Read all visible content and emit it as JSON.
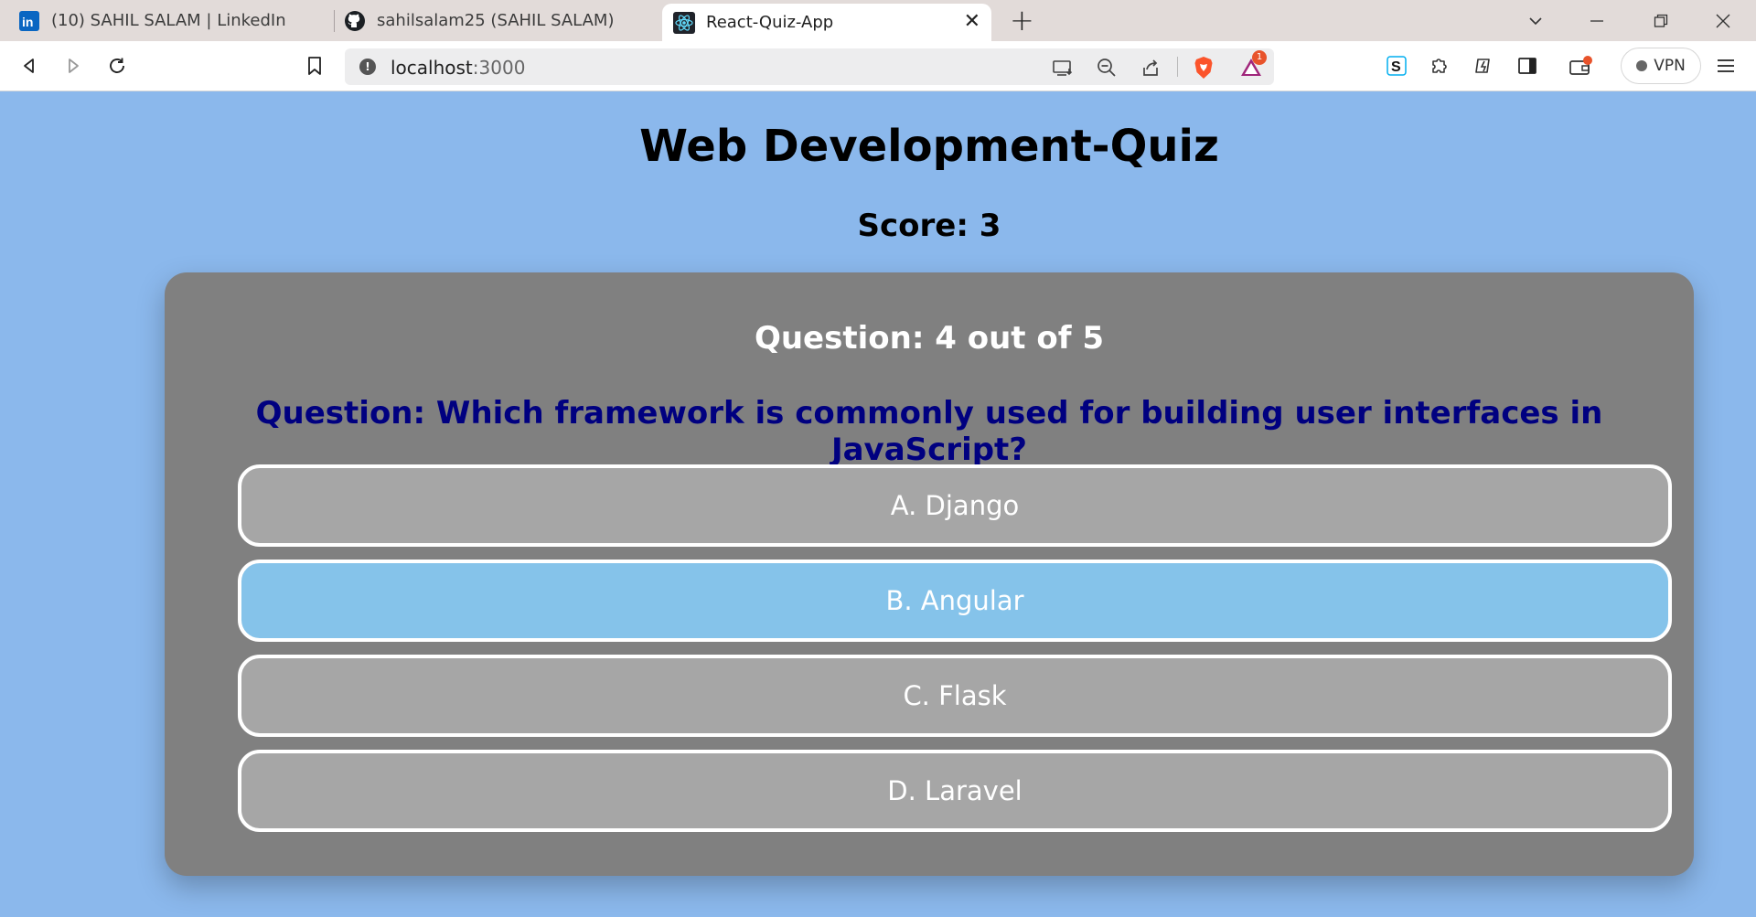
{
  "browser": {
    "tabs": [
      {
        "label": "(10) SAHIL SALAM | LinkedIn",
        "icon": "linkedin-icon"
      },
      {
        "label": "sahilsalam25 (SAHIL SALAM)",
        "icon": "github-icon"
      },
      {
        "label": "React-Quiz-App",
        "icon": "react-icon",
        "active": true
      }
    ],
    "url": {
      "host": "localhost",
      "port": ":3000"
    },
    "vpn_label": "VPN",
    "notification_count": "1"
  },
  "quiz": {
    "title": "Web Development-Quiz",
    "score": "Score: 3",
    "question_count": "Question: 4 out of 5",
    "question_text": "Question: Which framework is commonly used for building user interfaces in JavaScript?",
    "options": [
      {
        "label": "A. Django",
        "selected": false
      },
      {
        "label": "B. Angular",
        "selected": true
      },
      {
        "label": "C. Flask",
        "selected": false
      },
      {
        "label": "D. Laravel",
        "selected": false
      }
    ]
  },
  "colors": {
    "page_background": "#8bb8ec",
    "card_background": "#808080",
    "option_background": "#a6a6a6",
    "option_selected_background": "#85c3ea",
    "question_text": "#000080"
  }
}
